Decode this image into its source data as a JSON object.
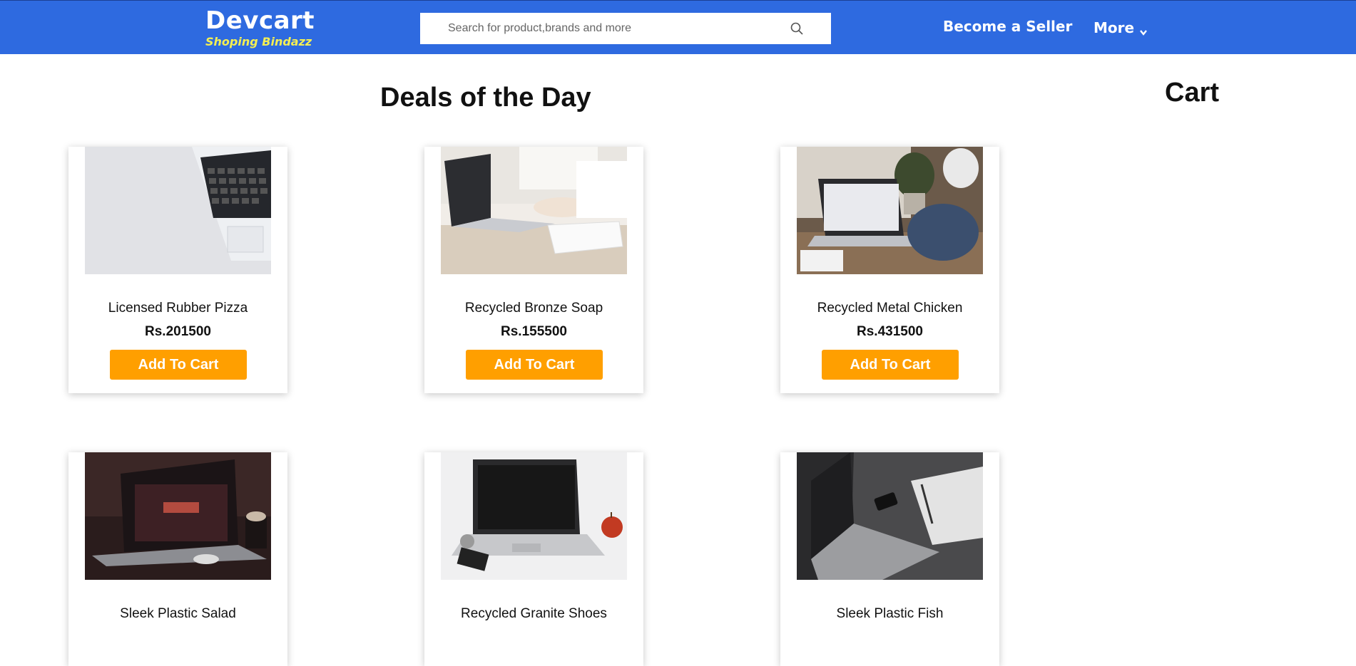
{
  "header": {
    "brand": "Devcart",
    "tagline": "Shoping Bindazz",
    "search_placeholder": "Search for product,brands and more",
    "search_icon": "search-icon",
    "become_seller": "Become a Seller",
    "more": "More",
    "more_icon": "chevron-down-icon"
  },
  "colors": {
    "navbar": "#2e6ae0",
    "tagline": "#f4ef53",
    "button": "#ff9f00"
  },
  "main": {
    "deals_title": "Deals of the Day",
    "cart_title": "Cart",
    "add_to_cart_label": "Add To Cart",
    "products": [
      {
        "name": "Licensed Rubber Pizza",
        "price": "Rs.201500",
        "image": "laptop-keyboard-corner-image"
      },
      {
        "name": "Recycled Bronze Soap",
        "price": "Rs.155500",
        "image": "typing-on-laptop-image"
      },
      {
        "name": "Recycled Metal Chicken",
        "price": "Rs.431500",
        "image": "laptop-on-desk-image"
      },
      {
        "name": "Sleek Plastic Salad",
        "image": "dark-laptop-image"
      },
      {
        "name": "Recycled Granite Shoes",
        "image": "laptop-with-apple-image"
      },
      {
        "name": "Sleek Plastic Fish",
        "image": "laptop-notebook-image"
      }
    ]
  }
}
